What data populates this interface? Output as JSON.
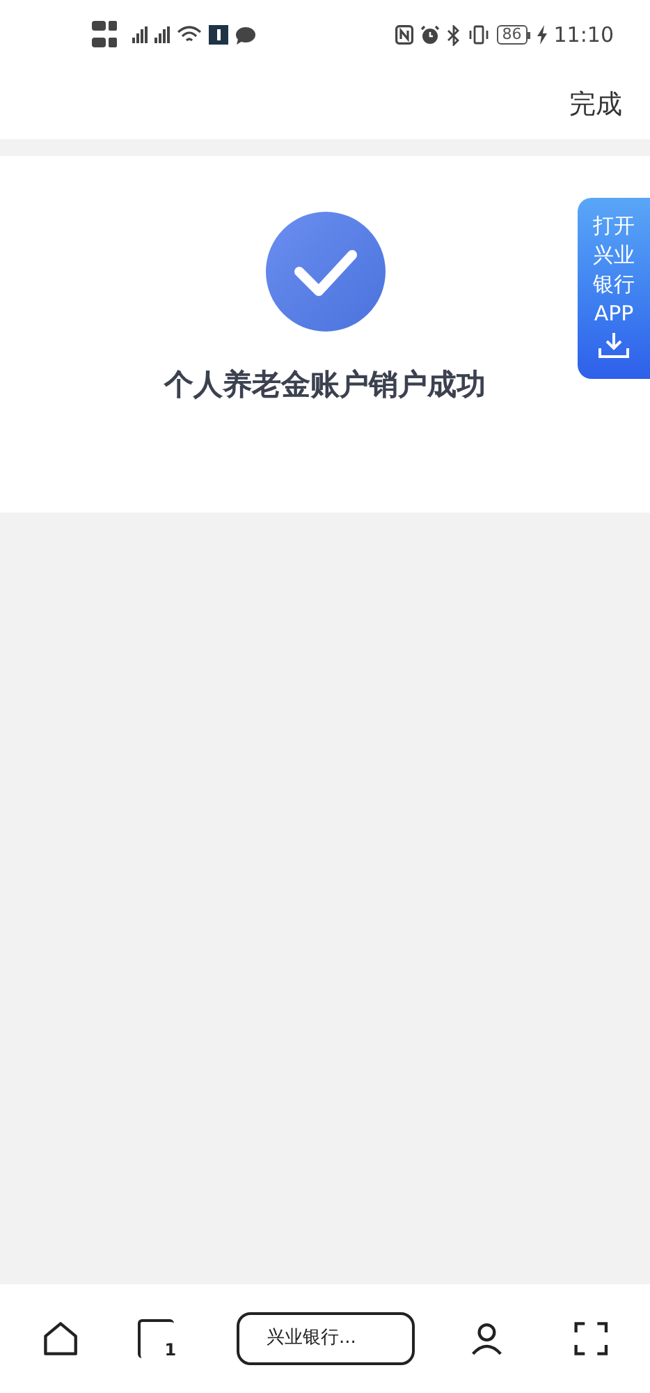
{
  "status_bar": {
    "battery": "86",
    "time": "11:10"
  },
  "header": {
    "done_button": "完成"
  },
  "result": {
    "message": "个人养老金账户销户成功"
  },
  "floating_banner": {
    "lines": [
      "打开",
      "兴业",
      "银行",
      "APP"
    ]
  },
  "bottom_bar": {
    "tab_count": "1",
    "current_tab": "兴业银行..."
  }
}
